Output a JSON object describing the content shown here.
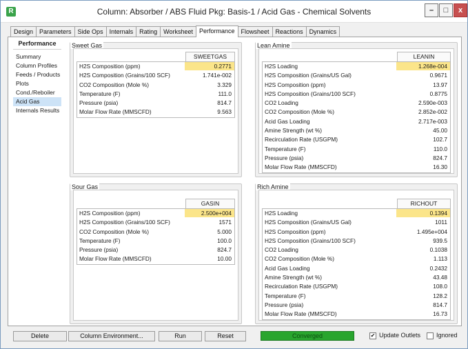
{
  "window": {
    "title": "Column: Absorber / ABS  Fluid Pkg: Basis-1 / Acid Gas - Chemical Solvents",
    "app_icon": "R",
    "minimize": "–",
    "maximize": "□",
    "close": "x"
  },
  "tabs": [
    "Design",
    "Parameters",
    "Side Ops",
    "Internals",
    "Rating",
    "Worksheet",
    "Performance",
    "Flowsheet",
    "Reactions",
    "Dynamics"
  ],
  "active_tab": "Performance",
  "nav": {
    "title": "Performance",
    "items": [
      "Summary",
      "Column Profiles",
      "Feeds / Products",
      "Plots",
      "Cond./Reboiler",
      "Acid Gas",
      "Internals Results"
    ],
    "active": "Acid Gas"
  },
  "sweet_gas": {
    "label": "Sweet Gas",
    "column": "SWEETGAS",
    "rows": [
      {
        "label": "H2S Composition (ppm)",
        "value": "0.2771",
        "highlight": true
      },
      {
        "label": "H2S Composition (Grains/100 SCF)",
        "value": "1.741e-002"
      },
      {
        "label": "CO2 Composition (Mole %)",
        "value": "3.329"
      },
      {
        "label": "Temperature (F)",
        "value": "111.0"
      },
      {
        "label": "Pressure (psia)",
        "value": "814.7"
      },
      {
        "label": "Molar Flow Rate (MMSCFD)",
        "value": "9.563"
      }
    ]
  },
  "lean_amine": {
    "label": "Lean Amine",
    "column": "LEANIN",
    "rows": [
      {
        "label": "H2S Loading",
        "value": "1.268e-004",
        "highlight": true
      },
      {
        "label": "H2S Composition (Grains/US Gal)",
        "value": "0.9671"
      },
      {
        "label": "H2S Composition (ppm)",
        "value": "13.97"
      },
      {
        "label": "H2S Composition (Grains/100 SCF)",
        "value": "0.8775"
      },
      {
        "label": "CO2 Loading",
        "value": "2.590e-003"
      },
      {
        "label": "CO2 Composition (Mole %)",
        "value": "2.852e-002"
      },
      {
        "label": "Acid Gas Loading",
        "value": "2.717e-003"
      },
      {
        "label": "Amine Strength (wt %)",
        "value": "45.00"
      },
      {
        "label": "Recirculation Rate (USGPM)",
        "value": "102.7"
      },
      {
        "label": "Temperature (F)",
        "value": "110.0"
      },
      {
        "label": "Pressure (psia)",
        "value": "824.7"
      },
      {
        "label": "Molar Flow Rate (MMSCFD)",
        "value": "16.30"
      }
    ]
  },
  "sour_gas": {
    "label": "Sour Gas",
    "column": "GASIN",
    "rows": [
      {
        "label": "H2S Composition (ppm)",
        "value": "2.500e+004",
        "highlight": true
      },
      {
        "label": "H2S Composition (Grains/100 SCF)",
        "value": "1571"
      },
      {
        "label": "CO2 Composition (Mole %)",
        "value": "5.000"
      },
      {
        "label": "Temperature (F)",
        "value": "100.0"
      },
      {
        "label": "Pressure (psia)",
        "value": "824.7"
      },
      {
        "label": "Molar Flow Rate (MMSCFD)",
        "value": "10.00"
      }
    ]
  },
  "rich_amine": {
    "label": "Rich Amine",
    "column": "RICHOUT",
    "rows": [
      {
        "label": "H2S Loading",
        "value": "0.1394",
        "highlight": true
      },
      {
        "label": "H2S Composition (Grains/US Gal)",
        "value": "1011"
      },
      {
        "label": "H2S Composition (ppm)",
        "value": "1.495e+004"
      },
      {
        "label": "H2S Composition (Grains/100 SCF)",
        "value": "939.5"
      },
      {
        "label": "CO2 Loading",
        "value": "0.1038"
      },
      {
        "label": "CO2 Composition (Mole %)",
        "value": "1.113"
      },
      {
        "label": "Acid Gas Loading",
        "value": "0.2432"
      },
      {
        "label": "Amine Strength (wt %)",
        "value": "43.48"
      },
      {
        "label": "Recirculation Rate (USGPM)",
        "value": "108.0"
      },
      {
        "label": "Temperature (F)",
        "value": "128.2"
      },
      {
        "label": "Pressure (psia)",
        "value": "814.7"
      },
      {
        "label": "Molar Flow Rate (MMSCFD)",
        "value": "16.73"
      }
    ]
  },
  "footer": {
    "delete": "Delete",
    "column_environment": "Column Environment...",
    "run": "Run",
    "reset": "Reset",
    "status": "Converged",
    "update_outlets": "Update Outlets",
    "update_outlets_checked": true,
    "ignored": "Ignored",
    "ignored_checked": false
  },
  "colors": {
    "highlight": "#fbe58a",
    "converged": "#29a52e",
    "nav_active": "#cde3f7",
    "close_button": "#c75050"
  }
}
